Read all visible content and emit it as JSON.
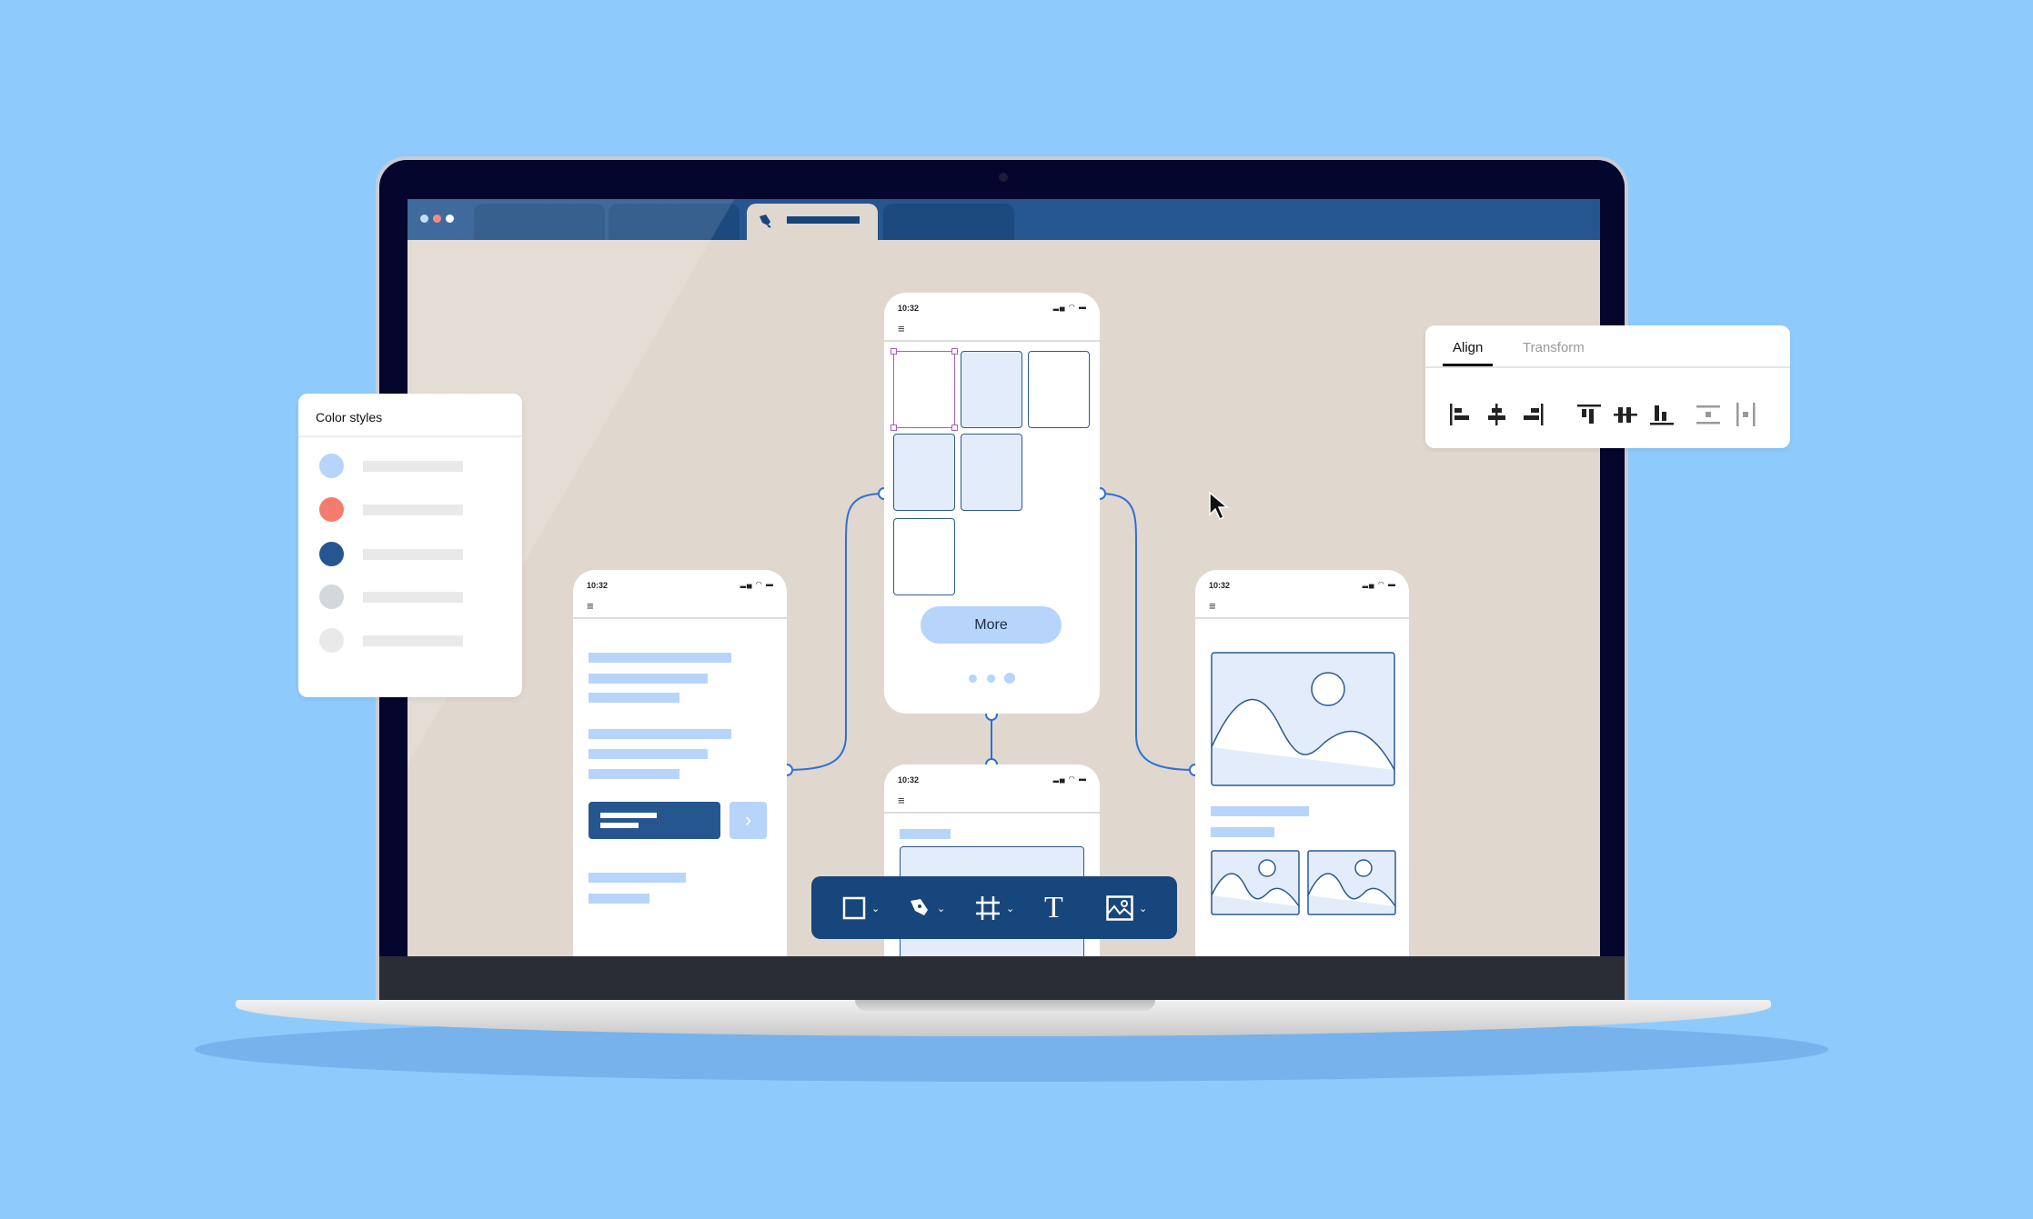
{
  "browser": {
    "tabs": [
      {
        "label": "",
        "active": false
      },
      {
        "label": "",
        "active": false
      },
      {
        "label": "",
        "active": true,
        "icon": "pen-nib-icon"
      },
      {
        "label": "",
        "active": false
      }
    ],
    "window_dots": [
      "#bcd8fb",
      "#f47c6c",
      "#ffffff"
    ]
  },
  "phones": {
    "time": "10:32",
    "status_icons": "signal-wifi-battery",
    "top": {
      "button": "More",
      "page_dots": 3,
      "active_dot": 3
    },
    "left": {},
    "right": {},
    "bottom": {}
  },
  "color_styles": {
    "title": "Color styles",
    "swatches": [
      "#b7d4fb",
      "#f47c6c",
      "#26568f",
      "#d3d8de",
      "#e9e9e9"
    ]
  },
  "align_panel": {
    "tabs": [
      {
        "label": "Align",
        "active": true
      },
      {
        "label": "Transform",
        "active": false
      }
    ],
    "icons": [
      "align-left-icon",
      "align-center-horizontal-icon",
      "align-right-icon",
      "align-top-icon",
      "align-center-vertical-icon",
      "align-bottom-icon",
      "distribute-vertical-icon",
      "distribute-horizontal-icon"
    ]
  },
  "toolbar": {
    "tools": [
      {
        "icon": "rectangle-icon",
        "dropdown": true
      },
      {
        "icon": "pen-tool-icon",
        "dropdown": true
      },
      {
        "icon": "frame-icon",
        "dropdown": true
      },
      {
        "icon": "text-tool-icon",
        "glyph": "T",
        "dropdown": false
      },
      {
        "icon": "image-icon",
        "dropdown": true
      }
    ]
  },
  "colors": {
    "background": "#8ecbfc",
    "canvas": "#e0d8cf",
    "accent": "#17467c",
    "connector": "#2f6fd6",
    "selection": "#a45dc9"
  }
}
